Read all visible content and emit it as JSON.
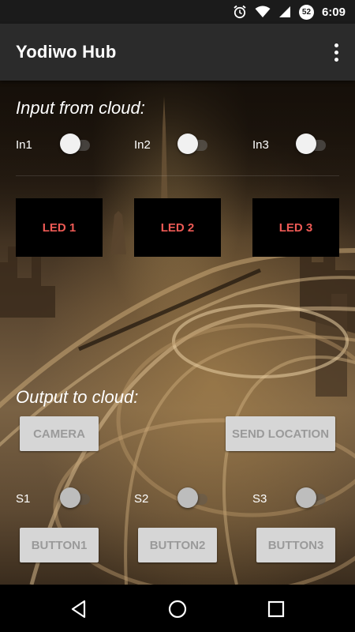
{
  "status_bar": {
    "time": "6:09",
    "battery_level": "52",
    "icons": [
      "alarm-icon",
      "wifi-icon",
      "signal-icon",
      "battery-icon"
    ]
  },
  "app_bar": {
    "title": "Yodiwo Hub",
    "overflow_icon": "more-vert-icon"
  },
  "input_section": {
    "title": "Input from cloud:",
    "switches": [
      {
        "label": "In1"
      },
      {
        "label": "In2"
      },
      {
        "label": "In3"
      }
    ],
    "leds": [
      {
        "label": "LED 1"
      },
      {
        "label": "LED 2"
      },
      {
        "label": "LED 3"
      }
    ]
  },
  "output_section": {
    "title": "Output to cloud:",
    "camera_button": "CAMERA",
    "send_location_button": "SEND LOCATION",
    "switches": [
      {
        "label": "S1"
      },
      {
        "label": "S2"
      },
      {
        "label": "S3"
      }
    ],
    "buttons": [
      {
        "label": "BUTTON1"
      },
      {
        "label": "BUTTON2"
      },
      {
        "label": "BUTTON3"
      }
    ]
  },
  "nav_bar": {
    "icons": [
      "back-icon",
      "home-icon",
      "recents-icon"
    ]
  },
  "colors": {
    "app_bar": "#2b2b2b",
    "led_text": "#ee5a55",
    "button_bg": "#d6d6d6",
    "button_text": "#9a9a9a"
  }
}
